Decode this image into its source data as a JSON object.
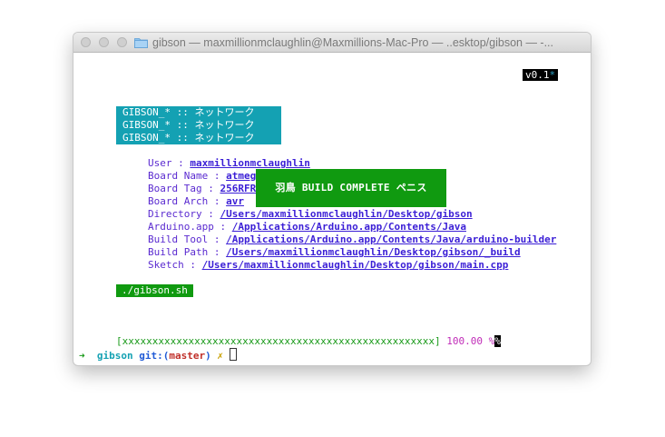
{
  "window": {
    "title": "gibson — maxmillionmclaughlin@Maxmillions-Mac-Pro — ..esktop/gibson — -..."
  },
  "terminal": {
    "version_label": "v0.1",
    "version_star": "*",
    "banner_lines": [
      "GIBSON_* :: ネットワーク",
      "GIBSON_* :: ネットワーク",
      "GIBSON_* :: ネットワーク"
    ],
    "info": [
      {
        "key": "User : ",
        "value": "maxmillionmclaughlin"
      },
      {
        "key": "Board Name : ",
        "value": "atmega"
      },
      {
        "key": "Board Tag : ",
        "value": "256RFR2"
      },
      {
        "key": "Board Arch : ",
        "value": "avr"
      },
      {
        "key": "Directory : ",
        "value": "/Users/maxmillionmclaughlin/Desktop/gibson"
      },
      {
        "key": "Arduino.app : ",
        "value": "/Applications/Arduino.app/Contents/Java"
      },
      {
        "key": "Build Tool : ",
        "value": "/Applications/Arduino.app/Contents/Java/arduino-builder"
      },
      {
        "key": "Build Path : ",
        "value": "/Users/maxmillionmclaughlin/Desktop/gibson/_build"
      },
      {
        "key": "Sketch : ",
        "value": "/Users/maxmillionmclaughlin/Desktop/gibson/main.cpp"
      }
    ],
    "build_message": "羽鳥 BUILD COMPLETE ペニス",
    "command": "./gibson.sh",
    "progress": {
      "bar": "[xxxxxxxxxxxxxxxxxxxxxxxxxxxxxxxxxxxxxxxxxxxxxxxxxxxx]",
      "percent_text": "100.00 %",
      "value": 100
    },
    "prompt": {
      "arrow": "➜",
      "dir": "gibson",
      "git_label": "git:(",
      "branch": "master",
      "git_close": ")",
      "dirty": "✗"
    }
  },
  "colors": {
    "banner_bg": "#14a1b3",
    "build_bg": "#109a10",
    "link": "#3b1fd6",
    "percent": "#c02cb8"
  }
}
